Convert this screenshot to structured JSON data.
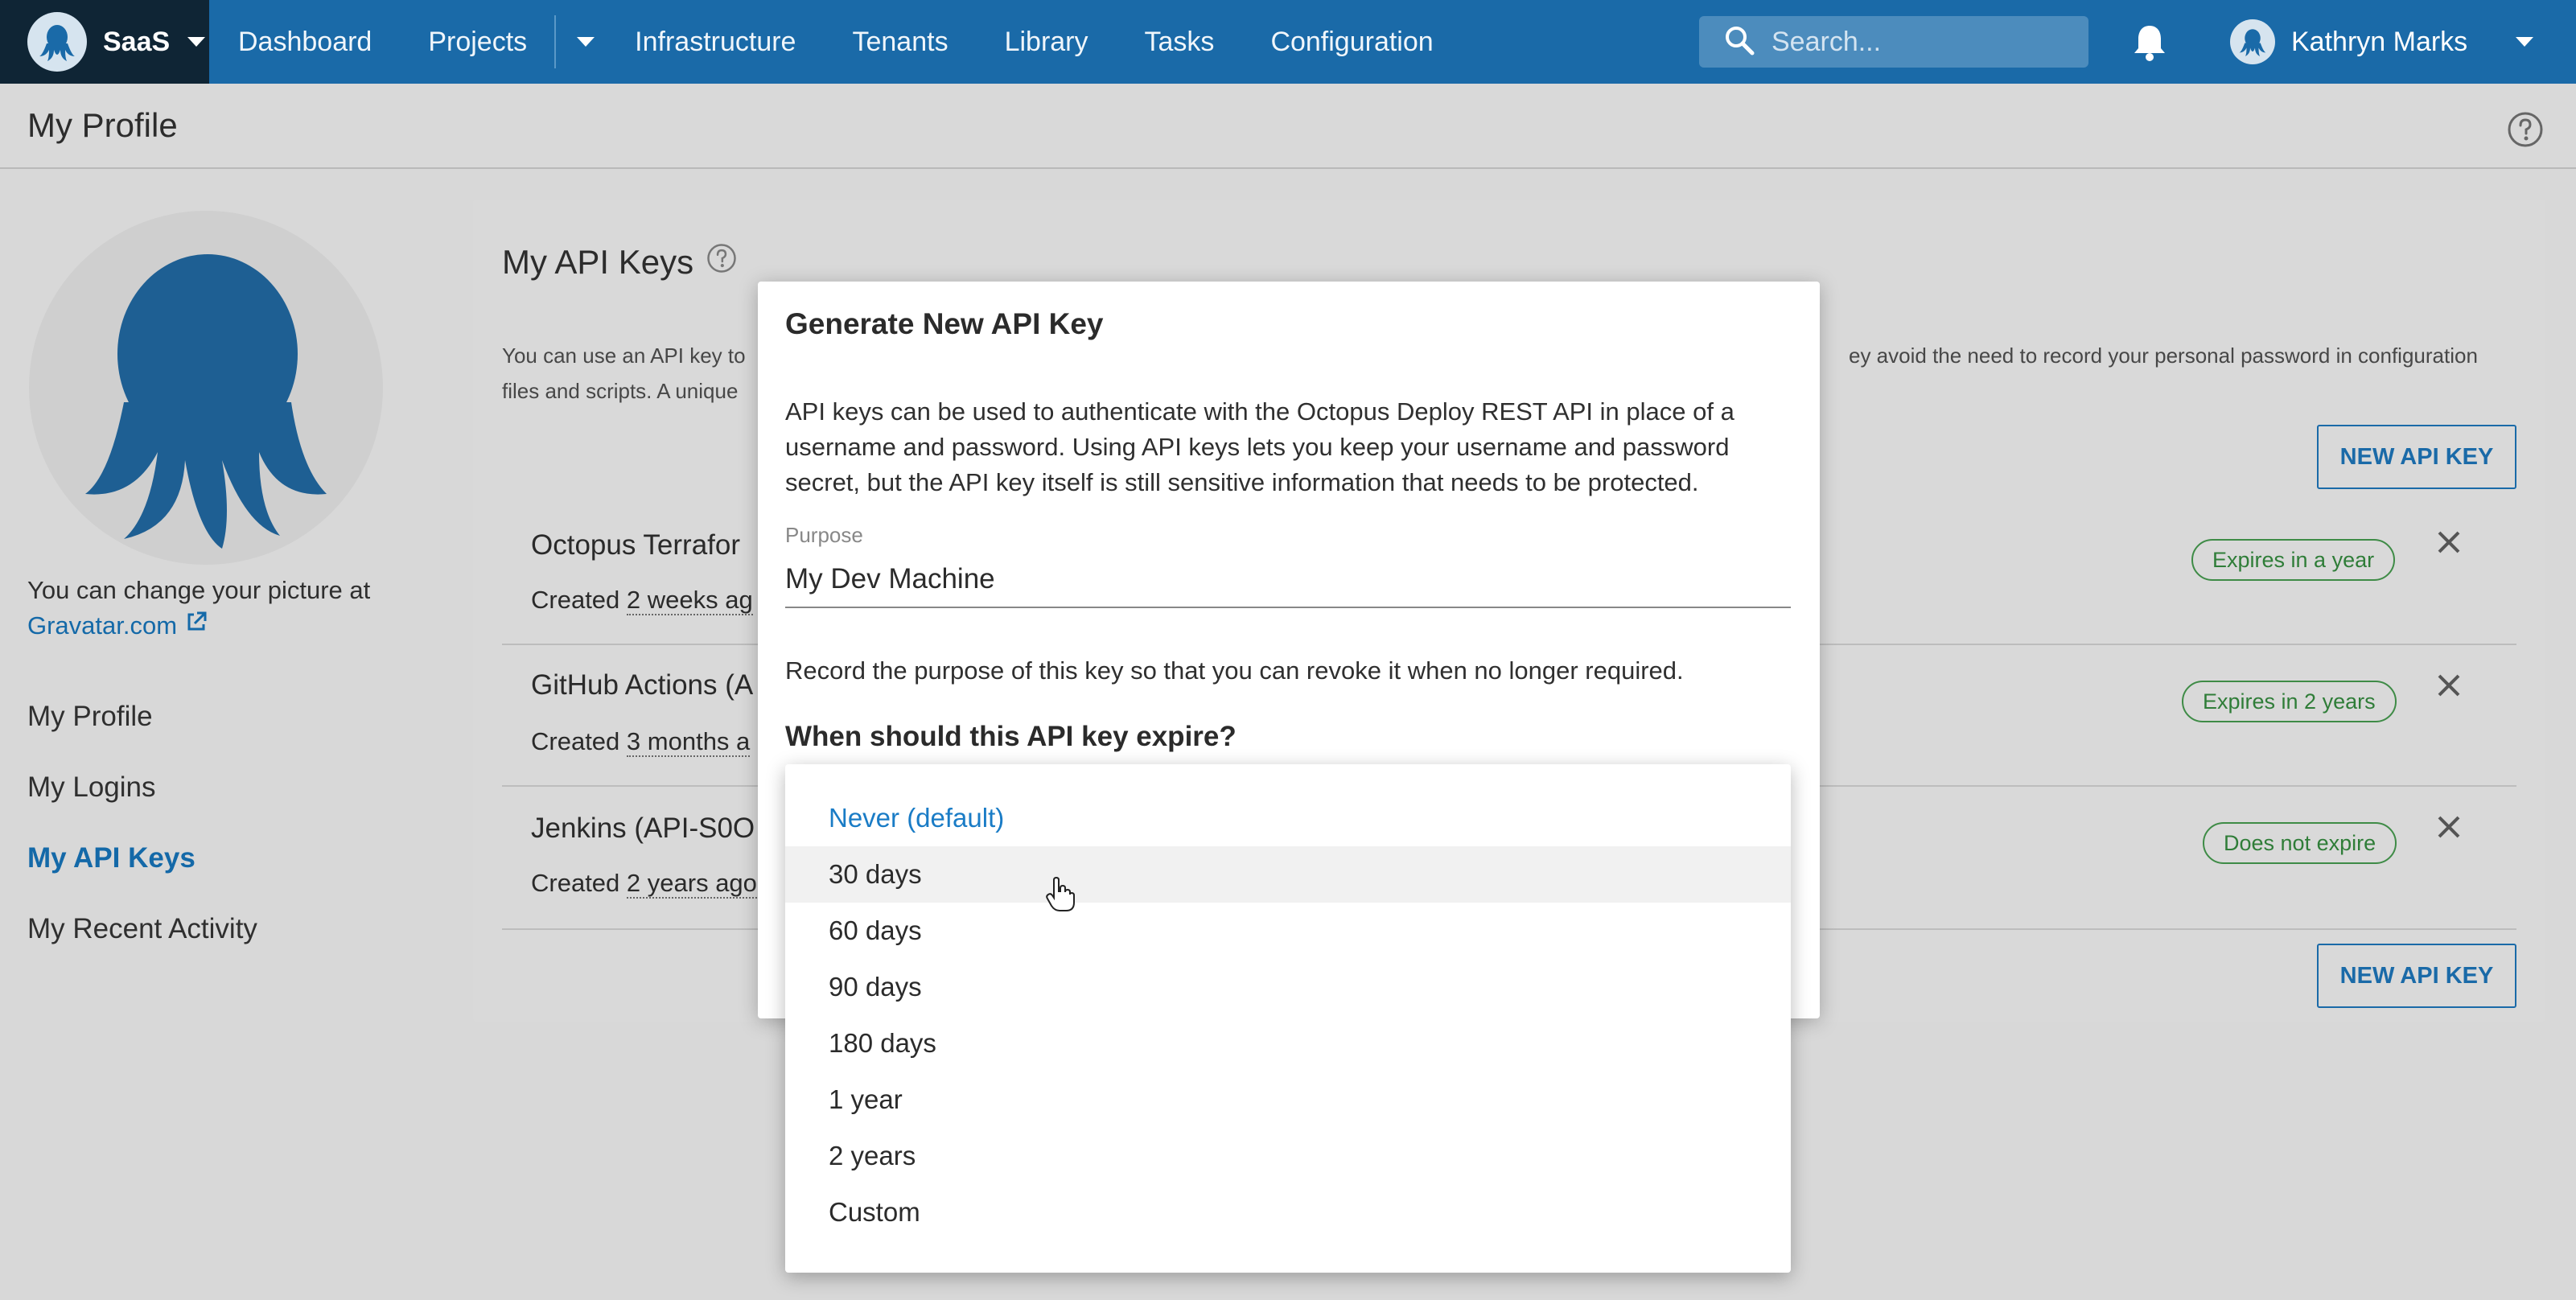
{
  "topnav": {
    "space_name": "SaaS",
    "links": [
      "Dashboard",
      "Projects",
      "Infrastructure",
      "Tenants",
      "Library",
      "Tasks",
      "Configuration"
    ],
    "search_placeholder": "Search...",
    "user_name": "Kathryn Marks"
  },
  "page": {
    "title": "My Profile"
  },
  "sidebar": {
    "picture_text": "You can change your picture at",
    "gravatar_link": "Gravatar.com",
    "items": [
      "My Profile",
      "My Logins",
      "My API Keys",
      "My Recent Activity"
    ],
    "active_item": "My API Keys"
  },
  "card": {
    "title": "My API Keys",
    "desc_left_line1": "You can use an API key to",
    "desc_left_line2": "files and scripts. A unique",
    "desc_right_line1": "ey avoid the need to record your personal password in configuration",
    "new_key_label": "NEW API KEY",
    "keys": [
      {
        "name": "Octopus Terrafor",
        "created_prefix": "Created",
        "created_ago": "2 weeks ag",
        "badge": "Expires in a year"
      },
      {
        "name": "GitHub Actions (A",
        "created_prefix": "Created",
        "created_ago": "3 months a",
        "badge": "Expires in 2 years"
      },
      {
        "name": "Jenkins (API-S0O",
        "created_prefix": "Created",
        "created_ago": "2 years ago",
        "badge": "Does not expire"
      }
    ]
  },
  "modal": {
    "title": "Generate New API Key",
    "description": "API keys can be used to authenticate with the Octopus Deploy REST API in place of a username and password. Using API keys lets you keep your username and password secret, but the API key itself is still sensitive information that needs to be protected.",
    "purpose_label": "Purpose",
    "purpose_value": "My Dev Machine",
    "purpose_help": "Record the purpose of this key so that you can revoke it when no longer required.",
    "expiry_question": "When should this API key expire?"
  },
  "expiry_dropdown": {
    "options": [
      "Never (default)",
      "30 days",
      "60 days",
      "90 days",
      "180 days",
      "1 year",
      "2 years",
      "Custom"
    ],
    "selected": "Never (default)",
    "hovered": "30 days"
  },
  "colors": {
    "nav_bg": "#1a6aa8",
    "brand_dark": "#0f2535",
    "link_blue": "#1469a8",
    "badge_green": "#2f7d38"
  }
}
